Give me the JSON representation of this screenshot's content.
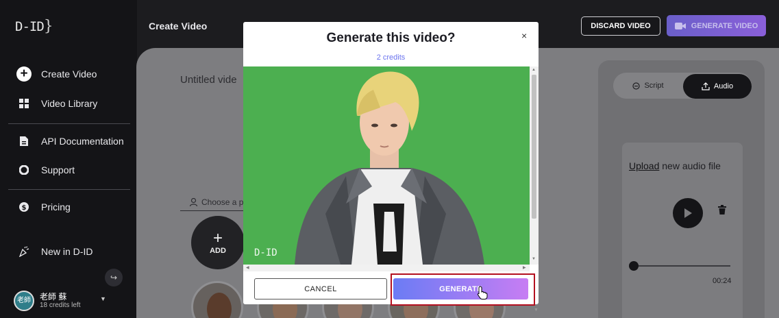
{
  "app": {
    "logo": "D-ID"
  },
  "sidebar": {
    "items": [
      {
        "label": "Create Video",
        "icon": "plus-circle-icon"
      },
      {
        "label": "Video Library",
        "icon": "grid-icon"
      },
      {
        "label": "API Documentation",
        "icon": "document-icon"
      },
      {
        "label": "Support",
        "icon": "lifebuoy-icon"
      },
      {
        "label": "Pricing",
        "icon": "dollar-icon"
      },
      {
        "label": "New in D-ID",
        "icon": "party-icon"
      }
    ],
    "user": {
      "avatar_text": "老師",
      "name": "老師 蘇",
      "credits": "18 credits left"
    }
  },
  "header": {
    "title": "Create Video",
    "discard_label": "DISCARD VIDEO",
    "generate_label": "GENERATE VIDEO"
  },
  "editor": {
    "video_title": "Untitled vide",
    "choose_label": "Choose a p",
    "add_label": "ADD"
  },
  "audio_panel": {
    "tab_script": "Script",
    "tab_audio": "Audio",
    "upload_link": "Upload",
    "upload_text": " new audio file",
    "duration": "00:24"
  },
  "modal": {
    "title": "Generate this video?",
    "credits": "2 credits",
    "close": "×",
    "watermark": "D-ID",
    "cancel_label": "CANCEL",
    "generate_label": "GENERATE"
  },
  "colors": {
    "accent": "#6b7cf4",
    "accent_end": "#c77df3",
    "green_screen": "#4caf50",
    "highlight": "#b30f1f"
  }
}
